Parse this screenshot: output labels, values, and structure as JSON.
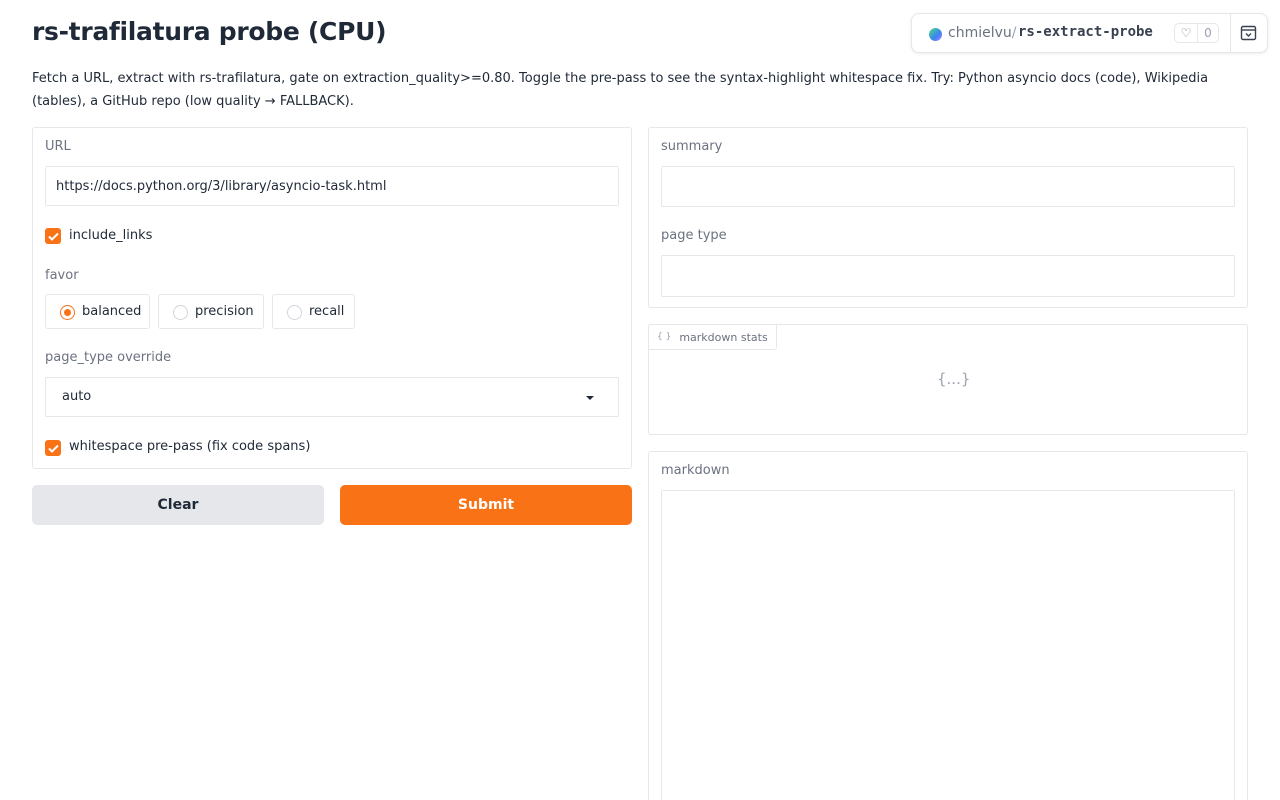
{
  "header": {
    "title": "rs-trafilatura probe (CPU)",
    "description": "Fetch a URL, extract with rs-trafilatura, gate on extraction_quality>=0.80. Toggle the pre-pass to see the syntax-highlight whitespace fix. Try: Python asyncio docs (code), Wikipedia (tables), a GitHub repo (low quality → FALLBACK)."
  },
  "space_badge": {
    "owner": "chmielvu",
    "separator": "/",
    "repo": "rs-extract-probe",
    "likes": "0",
    "icons": [
      "heart-icon",
      "collapse-icon"
    ],
    "accent": "#f97316"
  },
  "inputs": {
    "url_label": "URL",
    "url_value": "https://docs.python.org/3/library/asyncio-task.html",
    "include_links_label": "include_links",
    "include_links_checked": true,
    "favor_label": "favor",
    "favor_options": [
      "balanced",
      "precision",
      "recall"
    ],
    "favor_selected": "balanced",
    "page_type_label": "page_type override",
    "page_type_value": "auto",
    "whitespace_label": "whitespace pre-pass (fix code spans)",
    "whitespace_checked": true
  },
  "buttons": {
    "clear": "Clear",
    "submit": "Submit"
  },
  "outputs": {
    "summary_label": "summary",
    "summary_value": "",
    "page_type_label": "page type",
    "page_type_value": "",
    "stats_label": "markdown stats",
    "stats_icon": "{ }",
    "stats_placeholder": "{...}",
    "markdown_label": "markdown",
    "markdown_value": ""
  }
}
